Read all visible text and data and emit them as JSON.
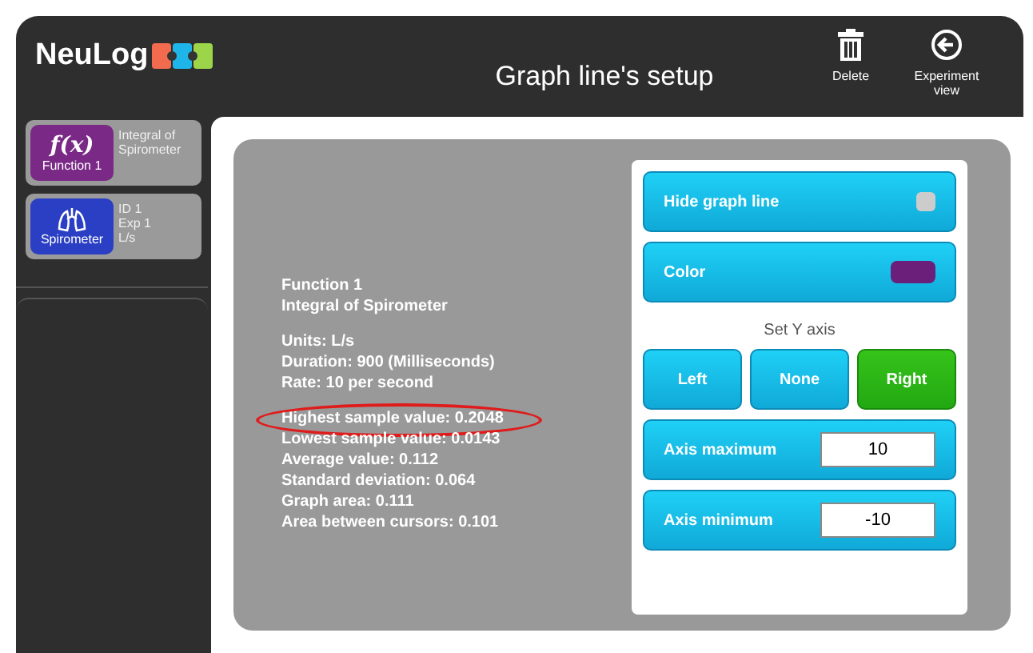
{
  "header": {
    "logo": "NeuLog",
    "title": "Graph line's setup",
    "actions": [
      {
        "kind": "delete",
        "label": "Delete"
      },
      {
        "kind": "back",
        "label": "Experiment view"
      }
    ]
  },
  "sidebar": {
    "items": [
      {
        "kind": "function",
        "badge": "f(x)",
        "badge_label": "Function 1",
        "lines": [
          "Integral of",
          "Spirometer"
        ],
        "color": "#7a2a86"
      },
      {
        "kind": "sensor",
        "badge_label": "Spirometer",
        "lines": [
          "ID 1",
          "Exp 1",
          "L/s"
        ],
        "color": "#2a3fc4"
      }
    ]
  },
  "info": {
    "groups": [
      [
        {
          "text": "Function 1",
          "circled": false
        },
        {
          "text": "Integral of Spirometer",
          "circled": false
        }
      ],
      [
        {
          "text": "Units: L/s",
          "circled": false
        },
        {
          "text": "Duration: 900 (Milliseconds)",
          "circled": false
        },
        {
          "text": "Rate: 10 per second",
          "circled": false
        }
      ],
      [
        {
          "text": "Highest sample value: 0.2048",
          "circled": true
        },
        {
          "text": "Lowest sample value: 0.0143",
          "circled": false
        },
        {
          "text": "Average value: 0.112",
          "circled": false
        },
        {
          "text": "Standard deviation: 0.064",
          "circled": false
        },
        {
          "text": "Graph area: 0.111",
          "circled": false
        },
        {
          "text": "Area between cursors: 0.101",
          "circled": false
        }
      ]
    ]
  },
  "settings": {
    "hide_graph_line": {
      "label": "Hide graph line",
      "on": false
    },
    "color": {
      "label": "Color",
      "color": "#6b1f7a"
    },
    "y_axis": {
      "label": "Set Y axis",
      "options": [
        {
          "label": "Left",
          "selected": false
        },
        {
          "label": "None",
          "selected": false
        },
        {
          "label": "Right",
          "selected": true
        }
      ]
    },
    "fields": [
      {
        "label": "Axis maximum",
        "value": "10"
      },
      {
        "label": "Axis minimum",
        "value": "-10"
      }
    ]
  }
}
